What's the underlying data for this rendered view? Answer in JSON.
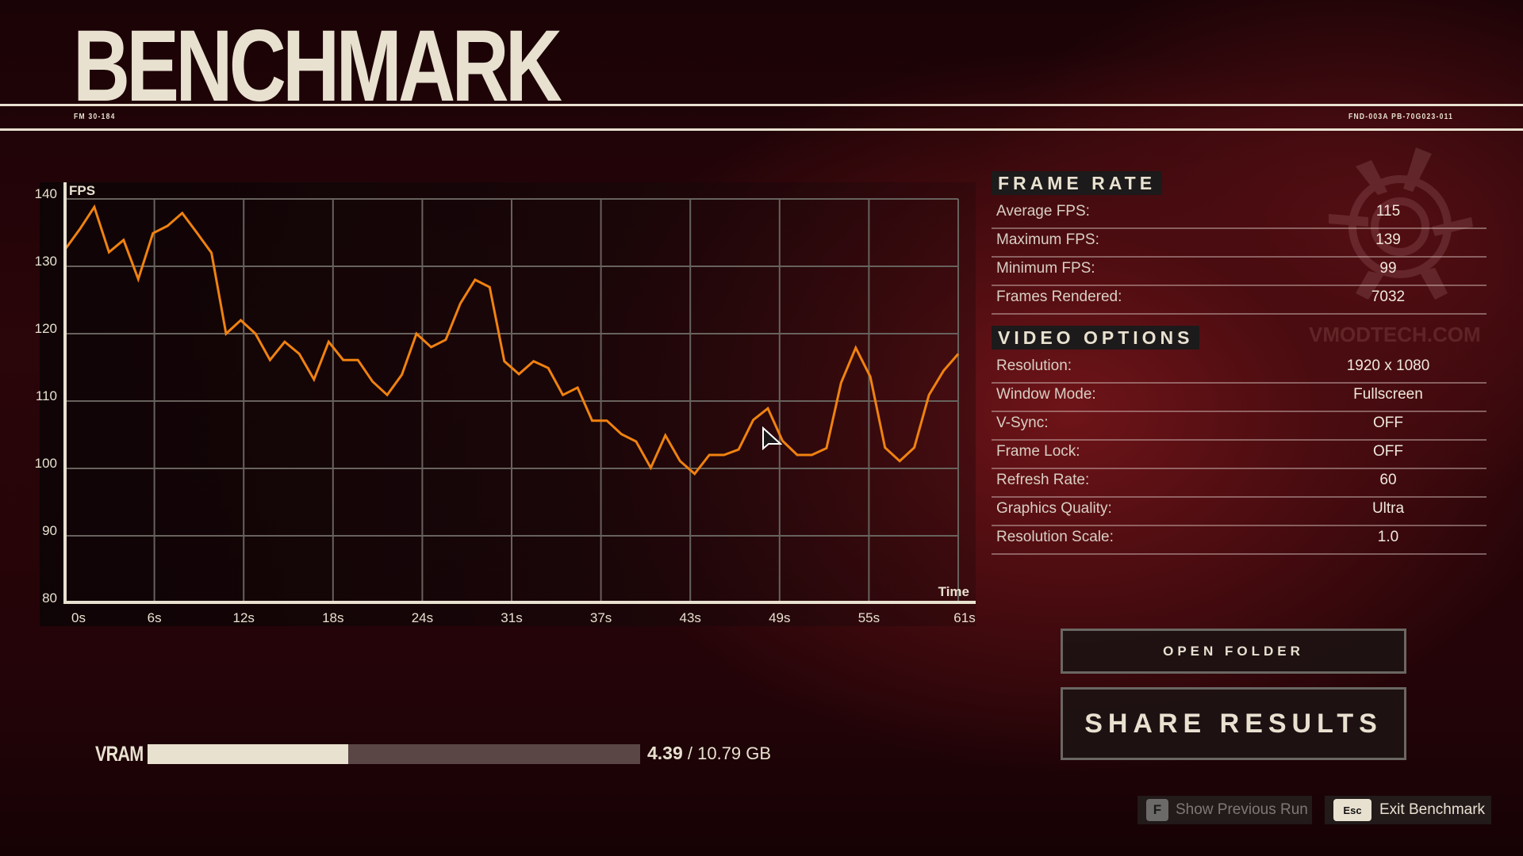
{
  "header": {
    "title": "BENCHMARK",
    "left_code": "FM 30-184",
    "right_code": "FND-003A PB-70G023-011"
  },
  "chart_data": {
    "type": "line",
    "title": "",
    "ylabel": "FPS",
    "xlabel": "Time",
    "ylim": [
      80,
      140
    ],
    "xlim": [
      0,
      61
    ],
    "yticks": [
      80,
      90,
      100,
      110,
      120,
      130,
      140
    ],
    "xtick_labels": [
      "0s",
      "6s",
      "12s",
      "18s",
      "24s",
      "31s",
      "37s",
      "43s",
      "49s",
      "55s",
      "61s"
    ],
    "grid": true,
    "line_color": "#f0820f",
    "series": [
      {
        "name": "FPS",
        "x": [
          0,
          1,
          2,
          3,
          4,
          5,
          6,
          7,
          8,
          9,
          10,
          11,
          12,
          13,
          14,
          15,
          16,
          17,
          18,
          19,
          20,
          21,
          22,
          23,
          24,
          25,
          26,
          27,
          28,
          29,
          30,
          31,
          32,
          33,
          34,
          35,
          36,
          37,
          38,
          39,
          40,
          41,
          42,
          43,
          44,
          45,
          46,
          47,
          48,
          49,
          50,
          51,
          52,
          53,
          54,
          55,
          56,
          57,
          58,
          59,
          60,
          61
        ],
        "values": [
          132.5,
          135.5,
          138.8,
          132.1,
          133.9,
          128.1,
          134.9,
          136.0,
          137.9,
          135.0,
          132.0,
          120.0,
          122.0,
          120.0,
          116.1,
          118.8,
          117.0,
          113.2,
          118.8,
          116.1,
          116.1,
          112.9,
          110.9,
          113.9,
          120.0,
          118.0,
          119.1,
          124.5,
          128.0,
          126.9,
          115.9,
          114.0,
          115.9,
          114.9,
          110.9,
          112.0,
          107.1,
          107.1,
          105.1,
          104.0,
          100.1,
          104.9,
          101.1,
          99.2,
          102.0,
          102.0,
          102.8,
          107.2,
          108.9,
          104.1,
          102.0,
          102.0,
          103.0,
          112.7,
          117.9,
          113.6,
          103.1,
          101.1,
          103.1,
          110.9,
          114.5,
          117.0
        ]
      }
    ]
  },
  "frame_rate": {
    "heading": "FRAME RATE",
    "rows": [
      {
        "label": "Average FPS:",
        "value": "115"
      },
      {
        "label": "Maximum FPS:",
        "value": "139"
      },
      {
        "label": "Minimum FPS:",
        "value": "99"
      },
      {
        "label": "Frames Rendered:",
        "value": "7032"
      }
    ]
  },
  "video_options": {
    "heading": "VIDEO OPTIONS",
    "rows": [
      {
        "label": "Resolution:",
        "value": "1920 x 1080"
      },
      {
        "label": "Window Mode:",
        "value": "Fullscreen"
      },
      {
        "label": "V-Sync:",
        "value": "OFF"
      },
      {
        "label": "Frame Lock:",
        "value": "OFF"
      },
      {
        "label": "Refresh Rate:",
        "value": "60"
      },
      {
        "label": "Graphics Quality:",
        "value": "Ultra"
      },
      {
        "label": "Resolution Scale:",
        "value": "1.0"
      }
    ]
  },
  "watermark": {
    "text": "VMODTECH.COM",
    "icon": "emblem-icon"
  },
  "buttons": {
    "open_folder": "OPEN FOLDER",
    "share_results": "SHARE RESULTS"
  },
  "vram": {
    "label": "VRAM",
    "used": "4.39",
    "total_text": "/ 10.79 GB",
    "used_fraction": 0.407
  },
  "hints": [
    {
      "key": "F",
      "label": "Show Previous Run",
      "enabled": false
    },
    {
      "key": "Esc",
      "label": "Exit Benchmark",
      "enabled": true
    }
  ],
  "colors": {
    "accent_line": "#f0820f",
    "text": "#e9e1d0",
    "grid": "#67625d"
  }
}
